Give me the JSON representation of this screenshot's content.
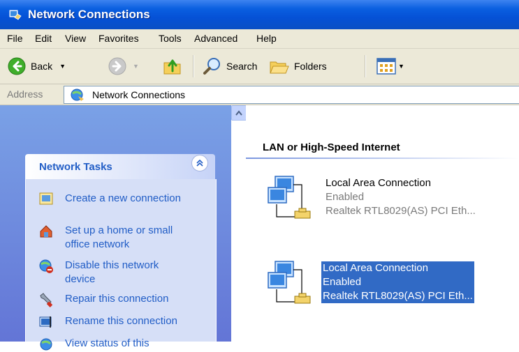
{
  "window": {
    "title": "Network Connections"
  },
  "menu": {
    "items": [
      "File",
      "Edit",
      "View",
      "Favorites",
      "Tools",
      "Advanced",
      "Help"
    ]
  },
  "toolbar": {
    "back_label": "Back",
    "search_label": "Search",
    "folders_label": "Folders"
  },
  "address": {
    "label": "Address",
    "value": "Network Connections"
  },
  "tasks": {
    "title": "Network Tasks",
    "items": [
      {
        "label": "Create a new connection",
        "icon": "new-connection-icon"
      },
      {
        "label": "Set up a home or small office network",
        "icon": "home-network-icon"
      },
      {
        "label": "Disable this network device",
        "icon": "disable-device-icon"
      },
      {
        "label": "Repair this connection",
        "icon": "repair-icon"
      },
      {
        "label": "Rename this connection",
        "icon": "rename-icon"
      },
      {
        "label": "View status of this",
        "icon": "status-icon"
      }
    ]
  },
  "main": {
    "group_header": "LAN or High-Speed Internet",
    "connections": [
      {
        "name": "Local Area Connection",
        "status": "Enabled",
        "device": "Realtek RTL8029(AS) PCI Eth...",
        "selected": false
      },
      {
        "name": "Local Area Connection",
        "status": "Enabled",
        "device": "Realtek RTL8029(AS) PCI Eth...",
        "selected": true
      }
    ]
  },
  "colors": {
    "title_bar": "#0551d6",
    "task_link": "#215dc6",
    "selection": "#316ac5"
  }
}
